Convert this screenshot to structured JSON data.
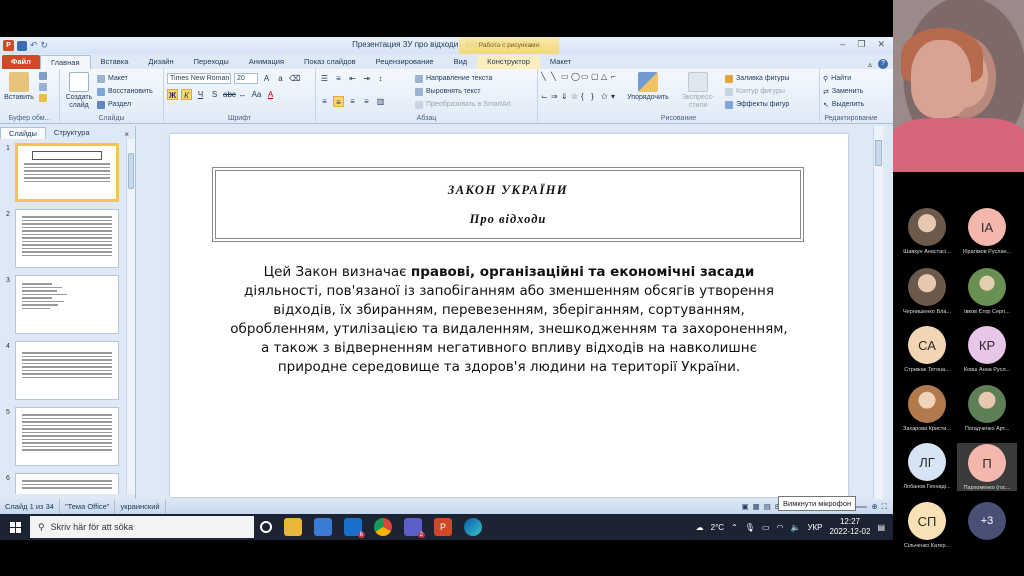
{
  "window": {
    "title": "Презентация ЗУ про відходи - Microsoft PowerPoint",
    "context_group": "Работа с рисунками"
  },
  "tabs": [
    "Файл",
    "Главная",
    "Вставка",
    "Дизайн",
    "Переходы",
    "Анимация",
    "Показ слайдов",
    "Рецензирование",
    "Вид",
    "Конструктор",
    "Макет"
  ],
  "ribbon": {
    "clipboard": {
      "paste": "Вставить",
      "label": "Буфер обм..."
    },
    "slides": {
      "create": "Создать слайд",
      "layout": "Макет",
      "reset": "Восстановить",
      "section": "Раздел",
      "label": "Слайды"
    },
    "font": {
      "name": "Times New Roman",
      "size": "20",
      "label": "Шрифт"
    },
    "paragraph": {
      "text_direction": "Направление текста",
      "align_text": "Выровнять текст",
      "smartart": "Преобразовать в SmartArt",
      "label": "Абзац"
    },
    "drawing": {
      "arrange": "Упорядочить",
      "quick_styles": "Экспресс-стили",
      "fill": "Заливка фигуры",
      "outline": "Контур фигуры",
      "effects": "Эффекты фигур",
      "label": "Рисование"
    },
    "editing": {
      "find": "Найти",
      "replace": "Заменить",
      "select": "Выделить",
      "label": "Редактирование"
    }
  },
  "pane": {
    "tab_slides": "Слайды",
    "tab_outline": "Структура",
    "close": "×",
    "numbers": [
      "1",
      "2",
      "3",
      "4",
      "5",
      "6"
    ]
  },
  "slide": {
    "law_title": "ЗАКОН УКРАЇНИ",
    "law_subtitle": "Про відходи",
    "body_pre": "Цей Закон визначає ",
    "body_bold": "правові, організаційні та економічні засади",
    "body_post": " діяльності, пов'язаної із запобіганням або зменшенням обсягів утворення відходів, їх збиранням, перевезенням, зберіганням, сортуванням, обробленням, утилізацією та видаленням, знешкодженням та захороненням, а також з відверненням негативного впливу відходів на навколишнє природне середовище та здоров'я людини на території України."
  },
  "statusbar": {
    "slide": "Слайд 1 из 34",
    "theme": "\"Тема Office\"",
    "language": "украинский",
    "zoom": "81",
    "tooltip": "Вимкнути мікрофон"
  },
  "taskbar": {
    "search_placeholder": "Skriv här för att söka",
    "temperature": "2°C",
    "lang": "УКР",
    "time": "12:27",
    "date": "2022-12-02",
    "badge_mail": "6",
    "badge_teams": "2"
  },
  "participants": [
    {
      "initials": "",
      "name": "Шавкун Анастасі...",
      "color": "#c9a58a"
    },
    {
      "initials": "IA",
      "name": "Ібрагімов Руслан...",
      "color": "#f4b7ae"
    },
    {
      "initials": "",
      "name": "Чернишенко Вла...",
      "color": "#6f8aa5"
    },
    {
      "initials": "",
      "name": "Івков Єгор Сергі...",
      "color": "#8fae6a"
    },
    {
      "initials": "СА",
      "name": "Стрижак Тетяна...",
      "color": "#f2d6b3"
    },
    {
      "initials": "КР",
      "name": "Ковш Анна Русл...",
      "color": "#e8c6e8"
    },
    {
      "initials": "",
      "name": "Захарова Кристи...",
      "color": "#c28b5a"
    },
    {
      "initials": "",
      "name": "Погадченко Арт...",
      "color": "#7a9b72"
    },
    {
      "initials": "ЛГ",
      "name": "Лобанов Геннаді...",
      "color": "#d7e4f4"
    },
    {
      "initials": "П",
      "name": "Пархоменко (гос...",
      "color": "#f4b7ae"
    },
    {
      "initials": "СП",
      "name": "Сільченко Катер...",
      "color": "#f7e1b5"
    },
    {
      "initials": "+3",
      "name": "",
      "color": "#4a4f75"
    }
  ]
}
